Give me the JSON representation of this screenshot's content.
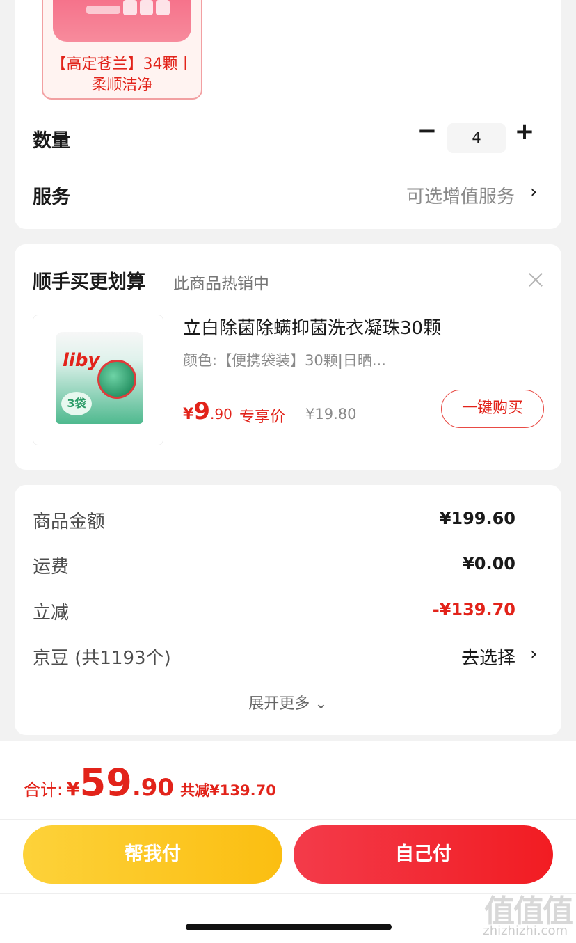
{
  "selected_variant": {
    "label": "【高定苍兰】34颗丨柔顺洁净"
  },
  "quantity": {
    "label": "数量",
    "minus": "−",
    "value": "4",
    "plus": "+"
  },
  "service": {
    "label": "服务",
    "value": "可选增值服务",
    "chevron": "›"
  },
  "upsell": {
    "title": "顺手买更划算",
    "subtitle": "此商品热销中",
    "product": {
      "brand_text": "liby",
      "badge_text": "3袋",
      "name": "立白除菌除螨抑菌洗衣凝珠30颗",
      "spec": "颜色:【便携袋装】30颗|日晒...",
      "price_symbol": "¥",
      "price_int": "9",
      "price_dec": ".90",
      "price_tag": "专享价",
      "original_price": "¥19.80",
      "buy_button": "一键购买"
    }
  },
  "summary": {
    "rows": [
      {
        "label": "商品金额",
        "value": "¥199.60"
      },
      {
        "label": "运费",
        "value": "¥0.00"
      },
      {
        "label": "立减",
        "value": "-¥139.70"
      },
      {
        "label": "京豆 (共1193个)",
        "value": "去选择"
      }
    ],
    "expand": "展开更多 ⌄"
  },
  "checkout": {
    "total_label": "合计:",
    "total_symbol": "¥",
    "total_int": "59",
    "total_dec": ".90",
    "saved": "共减¥139.70",
    "help_pay": "帮我付",
    "self_pay": "自己付"
  },
  "watermark": {
    "logo": "值值值",
    "url": "zhizhizhi.com"
  },
  "colors": {
    "accent_red": "#e2231a",
    "help_button": "#fbbe11",
    "self_button": "#f21c22"
  }
}
